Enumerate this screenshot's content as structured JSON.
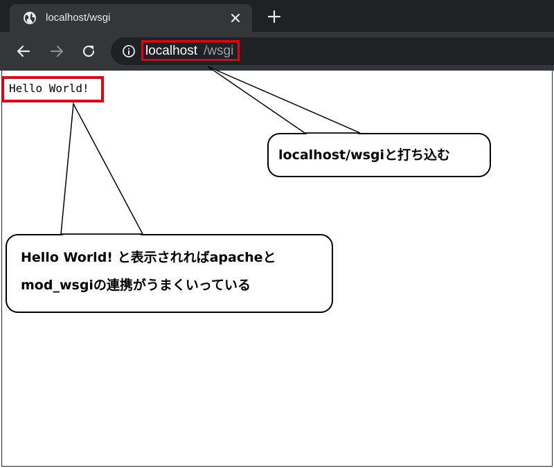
{
  "browser": {
    "tab": {
      "title": "localhost/wsgi",
      "icon": "globe-icon"
    },
    "address_bar": {
      "host": "localhost",
      "path": "/wsgi"
    },
    "colors": {
      "tabstrip": "#202124",
      "toolbar": "#35363a",
      "highlight": "#e60012"
    }
  },
  "page": {
    "content": "Hello World!"
  },
  "annotations": {
    "url_callout": "localhost/wsgiと打ち込む",
    "result_callout_line1": "Hello World! と表示されればapacheと",
    "result_callout_line2": "mod_wsgiの連携がうまくいっている"
  }
}
